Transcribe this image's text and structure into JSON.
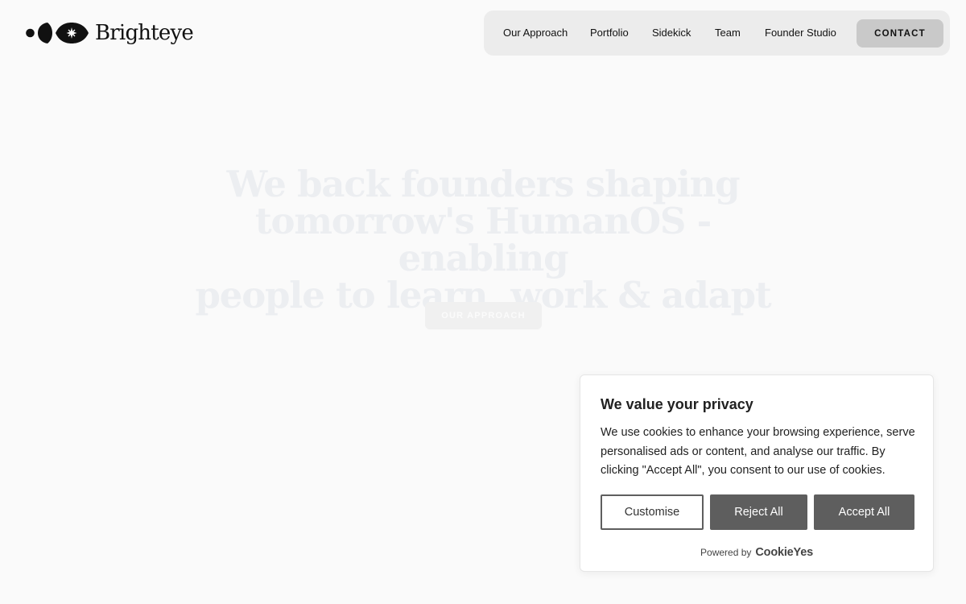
{
  "header": {
    "logo_text": "Brighteye",
    "nav": [
      {
        "label": "Our Approach"
      },
      {
        "label": "Portfolio"
      },
      {
        "label": "Sidekick"
      },
      {
        "label": "Team"
      },
      {
        "label": "Founder Studio"
      }
    ],
    "contact_label": "CONTACT"
  },
  "hero": {
    "title_lines": [
      "We back founders shaping",
      "tomorrow's HumanOS - enabling",
      "people to learn, work & adapt"
    ],
    "button_label": "OUR APPROACH"
  },
  "cookie": {
    "title": "We value your privacy",
    "text": "We use cookies to enhance your browsing experience, serve personalised ads or content, and analyse our traffic. By clicking \"Accept All\", you consent to our use of cookies.",
    "customise_label": "Customise",
    "reject_label": "Reject All",
    "accept_label": "Accept All",
    "powered_by": "Powered by",
    "powered_brand": "CookieYes"
  },
  "colors": {
    "background": "#fafafa",
    "nav_bg": "#ececec",
    "contact_bg": "#c9c9c9",
    "cookie_button": "#5e5e5e"
  },
  "icons": {
    "logo": "eye-sparkle-icon"
  }
}
